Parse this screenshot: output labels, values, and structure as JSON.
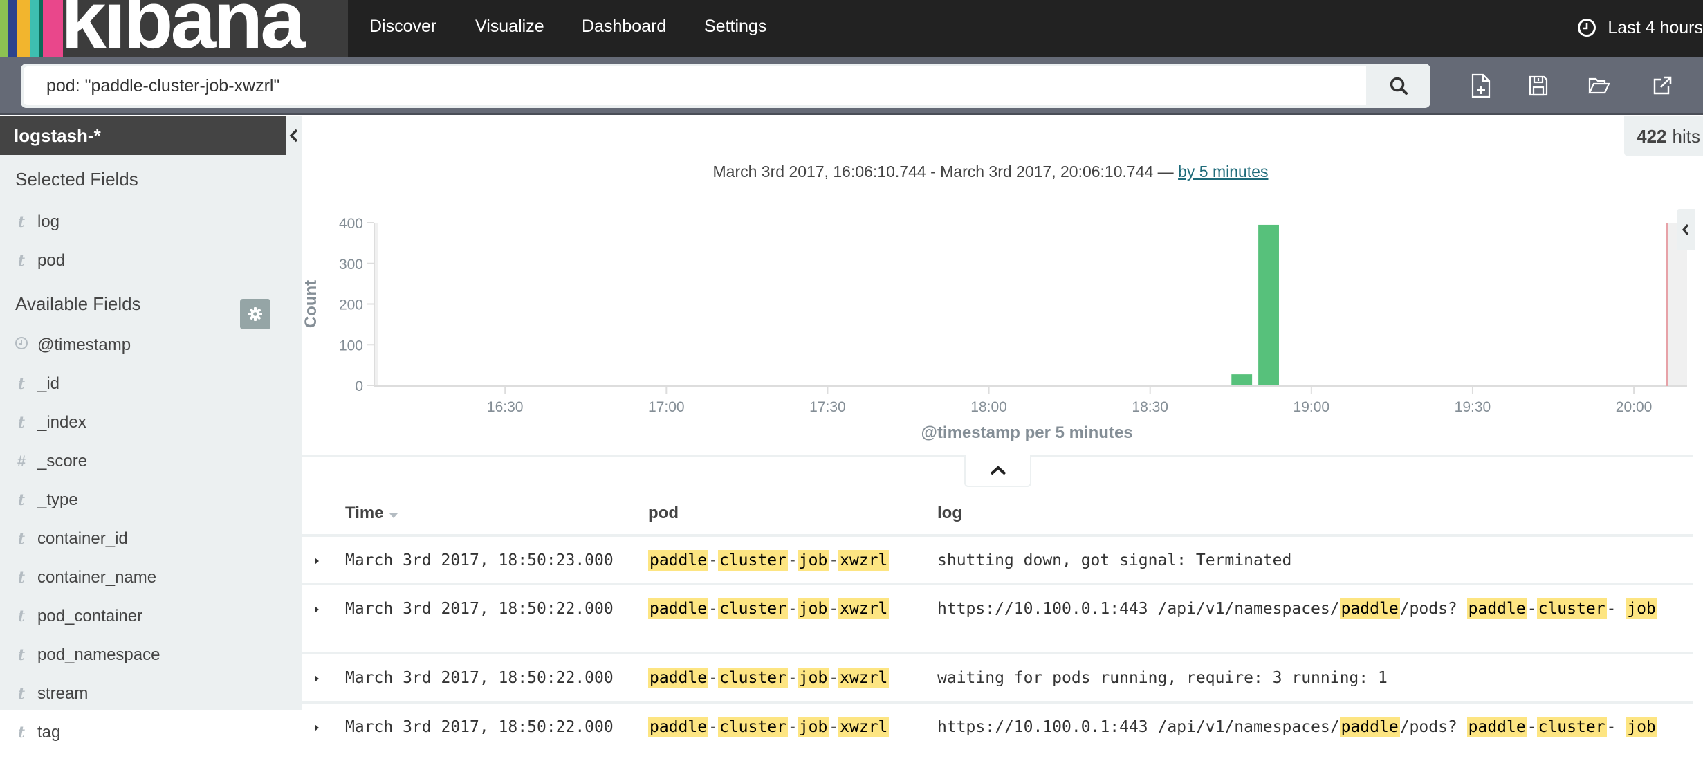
{
  "app": {
    "logo_text": "kibana",
    "logo_stripes": [
      "#8cc152",
      "#2d438c",
      "#f2b52e",
      "#3ebeb0",
      "#0c6b58",
      "#e9478b"
    ],
    "nav": [
      {
        "label": "Discover"
      },
      {
        "label": "Visualize"
      },
      {
        "label": "Dashboard"
      },
      {
        "label": "Settings"
      }
    ],
    "timepicker_label": "Last 4 hours"
  },
  "toolbar": {
    "query_value": "pod: \"paddle-cluster-job-xwzrl\"",
    "icons": [
      "search-icon",
      "new-document-icon",
      "save-icon",
      "open-folder-icon",
      "share-icon"
    ]
  },
  "sidebar": {
    "index_pattern": "logstash-*",
    "selected_heading": "Selected Fields",
    "selected_fields": [
      {
        "type": "t",
        "name": "log"
      },
      {
        "type": "t",
        "name": "pod"
      }
    ],
    "available_heading": "Available Fields",
    "available_fields": [
      {
        "type": "clock",
        "name": "@timestamp"
      },
      {
        "type": "t",
        "name": "_id"
      },
      {
        "type": "t",
        "name": "_index"
      },
      {
        "type": "#",
        "name": "_score"
      },
      {
        "type": "t",
        "name": "_type"
      },
      {
        "type": "t",
        "name": "container_id"
      },
      {
        "type": "t",
        "name": "container_name"
      },
      {
        "type": "t",
        "name": "pod_container"
      },
      {
        "type": "t",
        "name": "pod_namespace"
      },
      {
        "type": "t",
        "name": "stream"
      },
      {
        "type": "t",
        "name": "tag"
      }
    ]
  },
  "main": {
    "hits_count": "422",
    "hits_label": "hits",
    "range_text": "March 3rd 2017, 16:06:10.744 - March 3rd 2017, 20:06:10.744 — ",
    "interval_link": "by 5 minutes"
  },
  "colors": {
    "bar": "#57c17b",
    "now_line": "#e7a2a8",
    "highlight": "#fde582",
    "link": "#1f6b7a"
  },
  "chart_data": {
    "type": "bar",
    "title": "",
    "xlabel": "@timestamp per 5 minutes",
    "ylabel": "Count",
    "ylim": [
      0,
      400
    ],
    "yticks": [
      0,
      100,
      200,
      300,
      400
    ],
    "x_range": [
      "16:06:10",
      "20:06:10"
    ],
    "xticks": [
      "16:30",
      "17:00",
      "17:30",
      "18:00",
      "18:30",
      "19:00",
      "19:30",
      "20:00"
    ],
    "interval_minutes": 5,
    "categories": [
      "18:45",
      "18:50"
    ],
    "values": [
      27,
      395
    ],
    "now_marker": "20:06:10",
    "grid": false,
    "legend": "none"
  },
  "table": {
    "columns": [
      {
        "label": "Time",
        "sorted": "desc"
      },
      {
        "label": "pod"
      },
      {
        "label": "log"
      }
    ],
    "rows": [
      {
        "time": "March 3rd 2017, 18:50:23.000",
        "pod": [
          "paddle",
          "cluster",
          "job",
          "xwzrl"
        ],
        "log": [
          {
            "t": "shutting down, got signal: Terminated",
            "h": false
          }
        ]
      },
      {
        "time": "March 3rd 2017, 18:50:22.000",
        "pod": [
          "paddle",
          "cluster",
          "job",
          "xwzrl"
        ],
        "log": [
          {
            "t": "https://10.100.0.1:443 /api/v1/namespaces/",
            "h": false
          },
          {
            "t": "paddle",
            "h": true
          },
          {
            "t": "/pods? ",
            "h": false
          },
          {
            "t": "paddle",
            "h": true
          },
          {
            "t": "-",
            "h": false
          },
          {
            "t": "cluster",
            "h": true
          },
          {
            "t": "- ",
            "h": false
          },
          {
            "t": "job",
            "h": true
          }
        ]
      },
      {
        "time": "March 3rd 2017, 18:50:22.000",
        "pod": [
          "paddle",
          "cluster",
          "job",
          "xwzrl"
        ],
        "log": [
          {
            "t": "waiting for pods running, require: 3 running: 1",
            "h": false
          }
        ]
      },
      {
        "time": "March 3rd 2017, 18:50:22.000",
        "pod": [
          "paddle",
          "cluster",
          "job",
          "xwzrl"
        ],
        "log": [
          {
            "t": "https://10.100.0.1:443 /api/v1/namespaces/",
            "h": false
          },
          {
            "t": "paddle",
            "h": true
          },
          {
            "t": "/pods? ",
            "h": false
          },
          {
            "t": "paddle",
            "h": true
          },
          {
            "t": "-",
            "h": false
          },
          {
            "t": "cluster",
            "h": true
          },
          {
            "t": "- ",
            "h": false
          },
          {
            "t": "job",
            "h": true
          }
        ]
      }
    ]
  }
}
